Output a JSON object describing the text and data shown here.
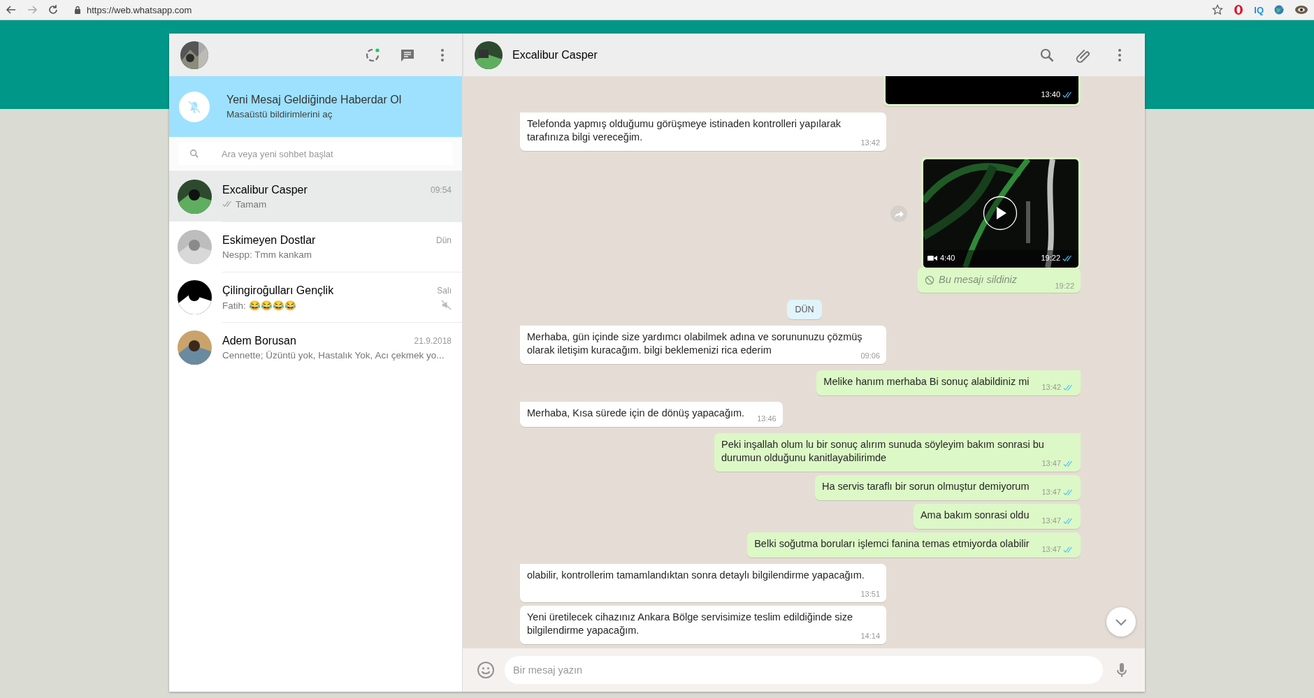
{
  "browser": {
    "url": "https://web.whatsapp.com",
    "extensions": [
      {
        "kind": "opera"
      },
      {
        "kind": "text",
        "label": "IQ"
      },
      {
        "kind": "globe"
      },
      {
        "kind": "profile"
      }
    ]
  },
  "sidebar": {
    "notification": {
      "title": "Yeni Mesaj Geldiğinde Haberdar Ol",
      "subtitle": "Masaüstü bildirimlerini aç"
    },
    "search": {
      "placeholder": "Ara veya yeni sohbet başlat"
    },
    "chats": [
      {
        "name": "Excalibur Casper",
        "time": "09:54",
        "preview": "Tamam",
        "sent": true,
        "muted": false,
        "selected": true
      },
      {
        "name": "Eskimeyen Dostlar",
        "time": "Dün",
        "preview": "Nespp: Tmm kankam",
        "sent": false,
        "muted": false,
        "selected": false
      },
      {
        "name": "Çilingiroğulları Gençlik",
        "time": "Salı",
        "preview": "Fatih: 😂😂😂😂",
        "sent": false,
        "muted": true,
        "selected": false
      },
      {
        "name": "Adem Borusan",
        "time": "21.9.2018",
        "preview": "Cennette; Üzüntü yok, Hastalık Yok, Acı çekmek yo...",
        "sent": false,
        "muted": false,
        "selected": false
      }
    ]
  },
  "conversation": {
    "title": "Excalibur Casper",
    "messages": [
      {
        "kind": "media",
        "outgoing": true,
        "time": "13:40",
        "read": true
      },
      {
        "kind": "text",
        "outgoing": false,
        "text": "Telefonda yapmış olduğumu görüşmeye istinaden kontrolleri yapılarak tarafınıza bilgi vereceğim.",
        "time": "13:42"
      },
      {
        "kind": "video",
        "outgoing": true,
        "duration": "4:40",
        "time": "19:22",
        "read": true
      },
      {
        "kind": "deleted",
        "outgoing": true,
        "text": "Bu mesajı sildiniz",
        "time": "19:22"
      },
      {
        "kind": "date",
        "text": "DÜN"
      },
      {
        "kind": "text",
        "outgoing": false,
        "text": "Merhaba, gün içinde size yardımcı olabilmek adına ve sorununuzu çözmüş olarak iletişim kuracağım. bilgi beklemenizi rica ederim",
        "time": "09:06"
      },
      {
        "kind": "text",
        "outgoing": true,
        "text": "Melike hanım merhaba Bi sonuç alabildiniz mi",
        "time": "13:42",
        "read": true
      },
      {
        "kind": "text",
        "outgoing": false,
        "text": "Merhaba, Kısa sürede için de dönüş yapacağım.",
        "time": "13:46"
      },
      {
        "kind": "text",
        "outgoing": true,
        "text": "Peki inşallah olum lu bir sonuç alırım sunuda söyleyim bakım sonrasi bu durumun olduğunu kanitlayabilirimde",
        "time": "13:47",
        "read": true
      },
      {
        "kind": "text",
        "outgoing": true,
        "text": "Ha servis taraflı bir sorun olmuştur demiyorum",
        "time": "13:47",
        "read": true
      },
      {
        "kind": "text",
        "outgoing": true,
        "text": "Ama bakım sonrasi oldu",
        "time": "13:47",
        "read": true
      },
      {
        "kind": "text",
        "outgoing": true,
        "text": "Belki soğutma boruları işlemci fanina temas etmiyorda olabilir",
        "time": "13:47",
        "read": true
      },
      {
        "kind": "text",
        "outgoing": false,
        "text": "olabilir, kontrollerim tamamlandıktan sonra detaylı bilgilendirme yapacağım.",
        "time": "13:51"
      },
      {
        "kind": "text",
        "outgoing": false,
        "text": "Yeni üretilecek cihazınız Ankara Bölge servisimize teslim edildiğinde size bilgilendirme yapacağım.",
        "time": "14:14"
      }
    ],
    "composer": {
      "placeholder": "Bir mesaj yazın"
    }
  }
}
